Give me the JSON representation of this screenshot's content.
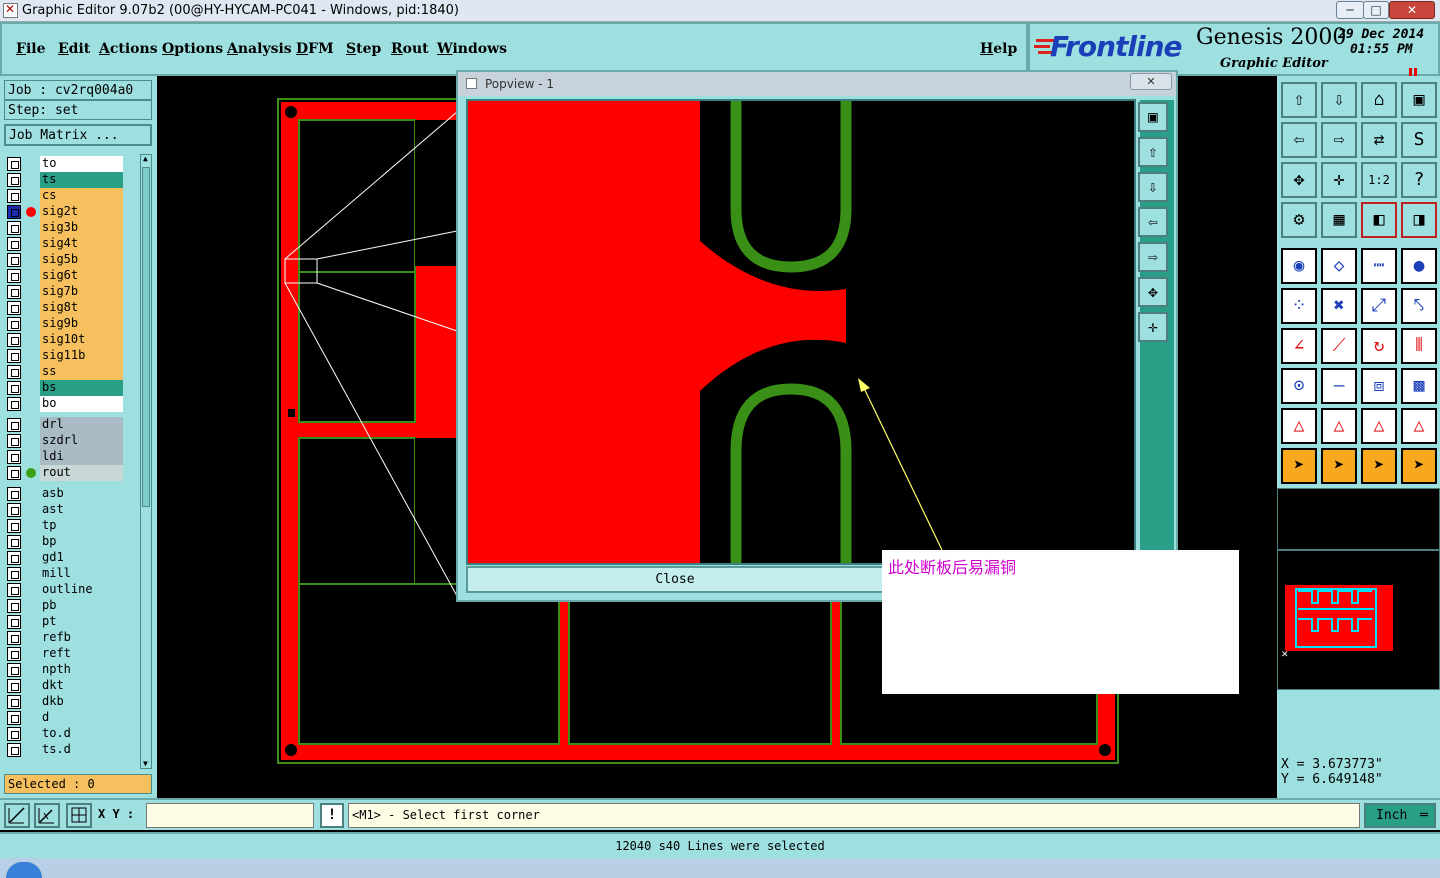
{
  "window": {
    "title": "Graphic Editor 9.07b2 (00@HY-HYCAM-PC041 - Windows, pid:1840)",
    "min_label": "─",
    "max_label": "□",
    "close_label": "✕"
  },
  "menu": {
    "items": [
      "File",
      "Edit",
      "Actions",
      "Options",
      "Analysis",
      "DFM",
      "Step",
      "Rout",
      "Windows"
    ],
    "help": "Help"
  },
  "brand": {
    "logo": "Frontline",
    "product": "Genesis 2000",
    "subtitle": "Graphic Editor",
    "date": "29 Dec 2014",
    "time": "01:55 PM"
  },
  "job": {
    "job_line": "Job : cv2rq004a0",
    "step_line": "Step: set",
    "matrix_button": "Job Matrix ..."
  },
  "layers": [
    {
      "name": "to",
      "color": "#ffffff"
    },
    {
      "name": "ts",
      "color": "#2a9f88"
    },
    {
      "name": "cs",
      "color": "#f7c05f"
    },
    {
      "name": "sig2t",
      "color": "#f7c05f",
      "active": true
    },
    {
      "name": "sig3b",
      "color": "#f7c05f"
    },
    {
      "name": "sig4t",
      "color": "#f7c05f"
    },
    {
      "name": "sig5b",
      "color": "#f7c05f"
    },
    {
      "name": "sig6t",
      "color": "#f7c05f"
    },
    {
      "name": "sig7b",
      "color": "#f7c05f"
    },
    {
      "name": "sig8t",
      "color": "#f7c05f"
    },
    {
      "name": "sig9b",
      "color": "#f7c05f"
    },
    {
      "name": "sig10t",
      "color": "#f7c05f"
    },
    {
      "name": "sig11b",
      "color": "#f7c05f"
    },
    {
      "name": "ss",
      "color": "#f7c05f"
    },
    {
      "name": "bs",
      "color": "#2a9f88"
    },
    {
      "name": "bo",
      "color": "#ffffff"
    },
    {
      "name": "drl",
      "color": "#a9bcc6"
    },
    {
      "name": "szdrl",
      "color": "#a9bcc6"
    },
    {
      "name": "ldi",
      "color": "#a9bcc6"
    },
    {
      "name": "rout",
      "color": "#c9d7d7",
      "work": true
    },
    {
      "name": "asb",
      "color": "#9edfe0"
    },
    {
      "name": "ast",
      "color": "#9edfe0"
    },
    {
      "name": "tp",
      "color": "#9edfe0"
    },
    {
      "name": "bp",
      "color": "#9edfe0"
    },
    {
      "name": "gd1",
      "color": "#9edfe0"
    },
    {
      "name": "mill",
      "color": "#9edfe0"
    },
    {
      "name": "outline",
      "color": "#9edfe0"
    },
    {
      "name": "pb",
      "color": "#9edfe0"
    },
    {
      "name": "pt",
      "color": "#9edfe0"
    },
    {
      "name": "refb",
      "color": "#9edfe0"
    },
    {
      "name": "reft",
      "color": "#9edfe0"
    },
    {
      "name": "npth",
      "color": "#9edfe0"
    },
    {
      "name": "dkt",
      "color": "#9edfe0"
    },
    {
      "name": "dkb",
      "color": "#9edfe0"
    },
    {
      "name": "d",
      "color": "#9edfe0"
    },
    {
      "name": "to.d",
      "color": "#9edfe0"
    },
    {
      "name": "ts.d",
      "color": "#9edfe0"
    }
  ],
  "selected": "Selected : 0",
  "popview": {
    "title": "Popview - 1",
    "close_button": "Close",
    "x_label": "✕"
  },
  "coords": {
    "x": "X  =  3.673773\"",
    "y": "Y  =  6.649148\""
  },
  "command": {
    "xy_label": "X Y :",
    "xy_value": "",
    "prompt": "<M1> - Select first corner",
    "units": "Inch"
  },
  "status": "12040 s40 Lines were selected",
  "annotation": "此处断板后易漏铜",
  "colors": {
    "panel": "#9edfe0",
    "copper": "#ff0000",
    "trace": "#3a8f16",
    "work": "#2a9f88"
  }
}
